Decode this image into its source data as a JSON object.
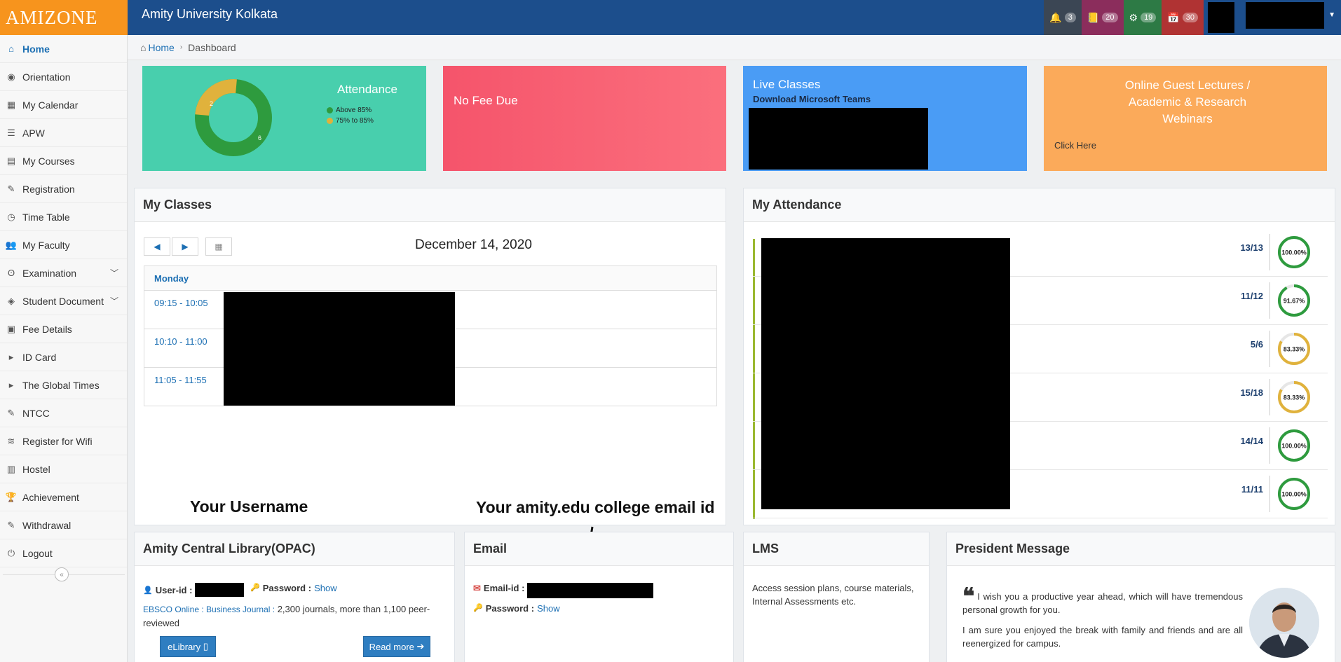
{
  "app": {
    "logo_text": "AMIZONE",
    "title": "Amity University Kolkata"
  },
  "header_badges": [
    {
      "icon": "bell-icon",
      "count": "3",
      "color": "#3b4654"
    },
    {
      "icon": "book-icon",
      "count": "20",
      "color": "#8b2d5c"
    },
    {
      "icon": "gear-icon",
      "count": "19",
      "color": "#2d7a45"
    },
    {
      "icon": "calendar-icon",
      "count": "30",
      "color": "#b03333"
    }
  ],
  "sidebar": {
    "items": [
      {
        "label": "Home",
        "icon": "home-icon"
      },
      {
        "label": "Orientation",
        "icon": "eye-icon"
      },
      {
        "label": "My Calendar",
        "icon": "calendar-icon"
      },
      {
        "label": "APW",
        "icon": "list-icon"
      },
      {
        "label": "My Courses",
        "icon": "book-icon"
      },
      {
        "label": "Registration",
        "icon": "edit-icon"
      },
      {
        "label": "Time Table",
        "icon": "clock-icon"
      },
      {
        "label": "My Faculty",
        "icon": "users-icon"
      },
      {
        "label": "Examination",
        "icon": "exam-icon"
      },
      {
        "label": "Student Document",
        "icon": "tag-icon"
      },
      {
        "label": "Fee Details",
        "icon": "money-icon"
      },
      {
        "label": "ID Card",
        "icon": "caret-right-icon"
      },
      {
        "label": "The Global Times",
        "icon": "caret-right-icon"
      },
      {
        "label": "NTCC",
        "icon": "edit-icon"
      },
      {
        "label": "Register for Wifi",
        "icon": "wifi-icon"
      },
      {
        "label": "Hostel",
        "icon": "hostel-icon"
      },
      {
        "label": "Achievement",
        "icon": "trophy-icon"
      },
      {
        "label": "Withdrawal",
        "icon": "edit-icon"
      },
      {
        "label": "Logout",
        "icon": "power-icon"
      }
    ]
  },
  "breadcrumb": {
    "home": "Home",
    "current": "Dashboard"
  },
  "tiles": {
    "attendance": {
      "label": "Attendance",
      "legend_above": "Above 85%",
      "legend_mid": "75% to 85%",
      "above_count": "6",
      "mid_count": "2"
    },
    "fee": {
      "label": "No Fee Due"
    },
    "live": {
      "label": "Live Classes",
      "sub": "Download Microsoft Teams"
    },
    "guest": {
      "label": "Online Guest Lectures / Academic & Research Webinars",
      "link": "Click Here"
    }
  },
  "classes": {
    "title": "My Classes",
    "date": "December 14, 2020",
    "day": "Monday",
    "slots": [
      "09:15 - 10:05",
      "10:10 - 11:00",
      "11:05 - 11:55"
    ]
  },
  "attendance_panel": {
    "title": "My Attendance",
    "rows": [
      {
        "fraction": "13/13",
        "percent": "100.00%",
        "fill": 1.0,
        "color": "#2e9b3e"
      },
      {
        "fraction": "11/12",
        "percent": "91.67%",
        "fill": 0.9167,
        "color": "#2e9b3e"
      },
      {
        "fraction": "5/6",
        "percent": "83.33%",
        "fill": 0.8333,
        "color": "#e0b23c"
      },
      {
        "fraction": "15/18",
        "percent": "83.33%",
        "fill": 0.8333,
        "color": "#e0b23c"
      },
      {
        "fraction": "14/14",
        "percent": "100.00%",
        "fill": 1.0,
        "color": "#2e9b3e"
      },
      {
        "fraction": "11/11",
        "percent": "100.00%",
        "fill": 1.0,
        "color": "#2e9b3e"
      }
    ]
  },
  "annotations": {
    "username": "Your Username",
    "email": "Your amity.edu college email id"
  },
  "library": {
    "title": "Amity Central Library(OPAC)",
    "userid_label": "User-id :",
    "password_label": "Password :",
    "show": "Show",
    "source": "EBSCO Online : Business Journal :",
    "desc": " 2,300 journals, more than 1,100 peer-reviewed",
    "elibrary_btn": "eLibrary",
    "readmore_btn": "Read more"
  },
  "email": {
    "title": "Email",
    "id_label": "Email-id :",
    "password_label": "Password :",
    "show": "Show"
  },
  "lms": {
    "title": "LMS",
    "text": "Access session plans, course materials, Internal Assessments etc."
  },
  "president": {
    "title": "President Message",
    "para1": "I wish you a productive year ahead, which will have tremendous personal growth for you.",
    "para2": "I am sure you enjoyed the break with family and friends and are all reenergized for campus."
  }
}
